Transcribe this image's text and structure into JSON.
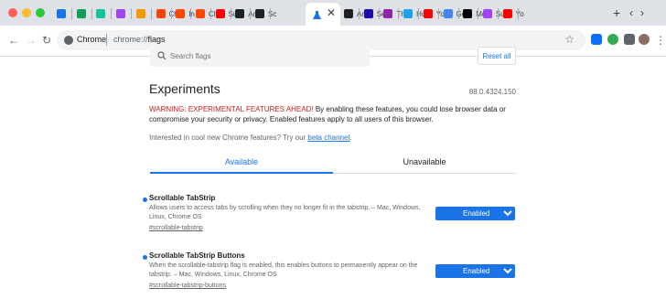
{
  "browser": {
    "tabs": [
      {
        "label": "",
        "icon": "feather-icon",
        "color": "#1a73e8"
      },
      {
        "label": "",
        "icon": "plus-icon",
        "color": "#0f9d58"
      },
      {
        "label": "",
        "icon": "grammarly-icon",
        "color": "#15c39a"
      },
      {
        "label": "",
        "icon": "circle-icon",
        "color": "#a142f4"
      },
      {
        "label": "",
        "icon": "face-icon",
        "color": "#f29900"
      },
      {
        "label": "Ch",
        "icon": "reddit-icon",
        "color": "#ff4500"
      },
      {
        "label": "In",
        "icon": "reddit-icon",
        "color": "#ff4500"
      },
      {
        "label": "Ch",
        "icon": "reddit-icon",
        "color": "#ff4500"
      },
      {
        "label": "Su",
        "icon": "youtube-icon",
        "color": "#ff0000"
      },
      {
        "label": "An",
        "icon": "flag-icon",
        "color": "#202124"
      },
      {
        "label": "Sc",
        "icon": "flag-icon",
        "color": "#202124"
      }
    ],
    "tabs_right": [
      {
        "label": "An",
        "icon": "flag-icon",
        "color": "#202124"
      },
      {
        "label": "Se",
        "icon": "s-icon",
        "color": "#1a0dab"
      },
      {
        "label": "Th",
        "icon": "slash-icon",
        "color": "#8e24aa"
      },
      {
        "label": "Hc",
        "icon": "twitter-icon",
        "color": "#1da1f2"
      },
      {
        "label": "Yo",
        "icon": "youtube-icon",
        "color": "#ff0000"
      },
      {
        "label": "Go",
        "icon": "google-icon",
        "color": "#4285f4"
      },
      {
        "label": "Me",
        "icon": "medium-icon",
        "color": "#000000"
      },
      {
        "label": "Su",
        "icon": "circle-icon",
        "color": "#a142f4"
      },
      {
        "label": "Yo",
        "icon": "youtube-icon",
        "color": "#ff0000"
      }
    ],
    "active_tab_close": "✕",
    "omnibox_scheme": "Chrome",
    "omnibox_url_prefix": "chrome://",
    "omnibox_url_path": "flags"
  },
  "flags_page": {
    "search_placeholder": "Search flags",
    "reset_all_label": "Reset all",
    "title": "Experiments",
    "version": "88.0.4324.150",
    "warning_prefix": "WARNING: EXPERIMENTAL FEATURES AHEAD!",
    "warning_text": " By enabling these features, you could lose browser data or compromise your security or privacy. Enabled features apply to all users of this browser.",
    "interest_text": "Interested in cool new Chrome features? Try our ",
    "beta_link": "beta channel",
    "interest_suffix": ".",
    "tab_available": "Available",
    "tab_unavailable": "Unavailable",
    "flags": [
      {
        "name": "Scrollable TabStrip",
        "description": "Allows users to access tabs by scrolling when they no longer fit in the tabstrip. – Mac, Windows, Linux, Chrome OS",
        "link": "#scrollable-tabstrip",
        "value": "Enabled"
      },
      {
        "name": "Scrollable TabStrip Buttons",
        "description": "When the scrollable-tabstrip flag is enabled, this enables buttons to permanently appear on the tabstrip. – Mac, Windows, Linux, Chrome OS",
        "link": "#scrollable-tabstrip-buttons",
        "value": "Enabled"
      }
    ]
  }
}
